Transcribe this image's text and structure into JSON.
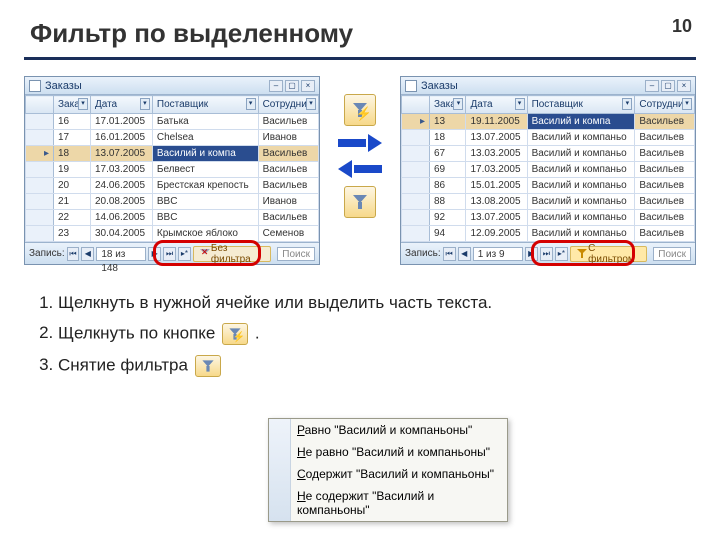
{
  "slide": {
    "title": "Фильтр по выделенному",
    "page": "10"
  },
  "left_window": {
    "title": "Заказы",
    "columns": [
      "Заказ",
      "Дата",
      "Поставщик",
      "Сотрудник"
    ],
    "rows": [
      {
        "n": "16",
        "d": "17.01.2005",
        "s": "Батька",
        "e": "Васильев"
      },
      {
        "n": "17",
        "d": "16.01.2005",
        "s": "Chelsea",
        "e": "Иванов"
      },
      {
        "n": "18",
        "d": "13.07.2005",
        "s": "Василий и компа",
        "e": "Васильев",
        "selected": true
      },
      {
        "n": "19",
        "d": "17.03.2005",
        "s": "Белвест",
        "e": "Васильев"
      },
      {
        "n": "20",
        "d": "24.06.2005",
        "s": "Брестская крепость",
        "e": "Васильев"
      },
      {
        "n": "21",
        "d": "20.08.2005",
        "s": "BBC",
        "e": "Иванов"
      },
      {
        "n": "22",
        "d": "14.06.2005",
        "s": "BBC",
        "e": "Васильев"
      },
      {
        "n": "23",
        "d": "30.04.2005",
        "s": "Крымское яблоко",
        "e": "Семенов"
      }
    ],
    "record_label": "Запись:",
    "record_pos": "18 из 148",
    "filter_label": "Без фильтра",
    "search_placeholder": "Поиск"
  },
  "right_window": {
    "title": "Заказы",
    "columns": [
      "Заказ",
      "Дата",
      "Поставщик",
      "Сотрудник"
    ],
    "rows": [
      {
        "n": "13",
        "d": "19.11.2005",
        "s": "Василий и компа",
        "e": "Васильев",
        "selected": true
      },
      {
        "n": "18",
        "d": "13.07.2005",
        "s": "Василий и компаньо",
        "e": "Васильев"
      },
      {
        "n": "67",
        "d": "13.03.2005",
        "s": "Василий и компаньо",
        "e": "Васильев"
      },
      {
        "n": "69",
        "d": "17.03.2005",
        "s": "Василий и компаньо",
        "e": "Васильев"
      },
      {
        "n": "86",
        "d": "15.01.2005",
        "s": "Василий и компаньо",
        "e": "Васильев"
      },
      {
        "n": "88",
        "d": "13.08.2005",
        "s": "Василий и компаньо",
        "e": "Васильев"
      },
      {
        "n": "92",
        "d": "13.07.2005",
        "s": "Василий и компаньо",
        "e": "Васильев"
      },
      {
        "n": "94",
        "d": "12.09.2005",
        "s": "Василий и компаньо",
        "e": "Васильев"
      }
    ],
    "record_label": "Запись:",
    "record_pos": "1 из 9",
    "filter_label": "С фильтром",
    "search_placeholder": "Поиск"
  },
  "steps": {
    "s1": "Щелкнуть в нужной ячейке или выделить часть текста.",
    "s2a": "Щелкнуть по кнопке ",
    "s2b": ".",
    "s3": "Снятие фильтра"
  },
  "menu": {
    "items": [
      {
        "u": "Р",
        "rest": "авно \"Василий и компаньоны\""
      },
      {
        "u": "Н",
        "rest": "е равно \"Василий и компаньоны\""
      },
      {
        "u": "С",
        "rest": "одержит \"Василий и компаньоны\""
      },
      {
        "u": "Н",
        "rest": "е содержит \"Василий и компаньоны\""
      }
    ]
  }
}
